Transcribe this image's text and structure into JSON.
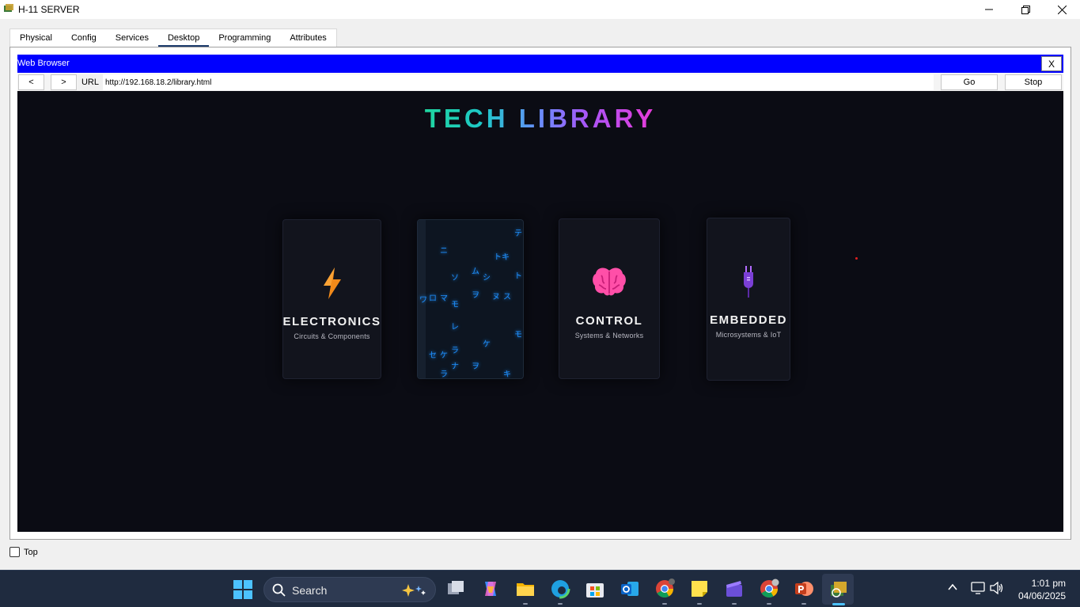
{
  "window": {
    "title": "H-11 SERVER"
  },
  "tabs": [
    {
      "label": "Physical"
    },
    {
      "label": "Config"
    },
    {
      "label": "Services"
    },
    {
      "label": "Desktop",
      "active": true
    },
    {
      "label": "Programming"
    },
    {
      "label": "Attributes"
    }
  ],
  "browser": {
    "title": "Web Browser",
    "close_label": "X",
    "back_label": "<",
    "forward_label": ">",
    "url_label": "URL",
    "url_value": "http://192.168.18.2/library.html",
    "go_label": "Go",
    "stop_label": "Stop"
  },
  "page": {
    "title": "TECH LIBRARY",
    "cards": [
      {
        "title": "ELECTRONICS",
        "subtitle": "Circuits & Components",
        "icon": "lightning-icon"
      },
      {
        "title": "",
        "subtitle": "",
        "icon": "matrix-rain"
      },
      {
        "title": "CONTROL",
        "subtitle": "Systems & Networks",
        "icon": "brain-icon"
      },
      {
        "title": "EMBEDDED",
        "subtitle": "Microsystems & IoT",
        "icon": "plug-icon"
      }
    ],
    "matrix_glyphs": [
      "テ",
      "ニ",
      "トキ",
      "ム",
      "ソ",
      "シ",
      "ト",
      "ワ",
      "ロ",
      "マ",
      "ヲ",
      "ヌ",
      "ス",
      "モ",
      "レ",
      "ケ",
      "モ",
      "セ",
      "ケ",
      "ラ",
      "ナ",
      "ヲ",
      "ラ",
      "キ"
    ]
  },
  "footer": {
    "top_label": "Top"
  },
  "taskbar": {
    "search_placeholder": "Search",
    "time": "1:01 pm",
    "date": "04/06/2025",
    "apps": [
      "task-view",
      "copilot",
      "file-explorer",
      "edge",
      "store",
      "outlook",
      "chrome",
      "sticky-notes",
      "clipchamp",
      "chrome-profile",
      "powerpoint",
      "packet-tracer"
    ]
  },
  "colors": {
    "browser_title_bar": "#0000ff",
    "page_background": "#0b0c14",
    "taskbar": "#1f2b3f"
  }
}
